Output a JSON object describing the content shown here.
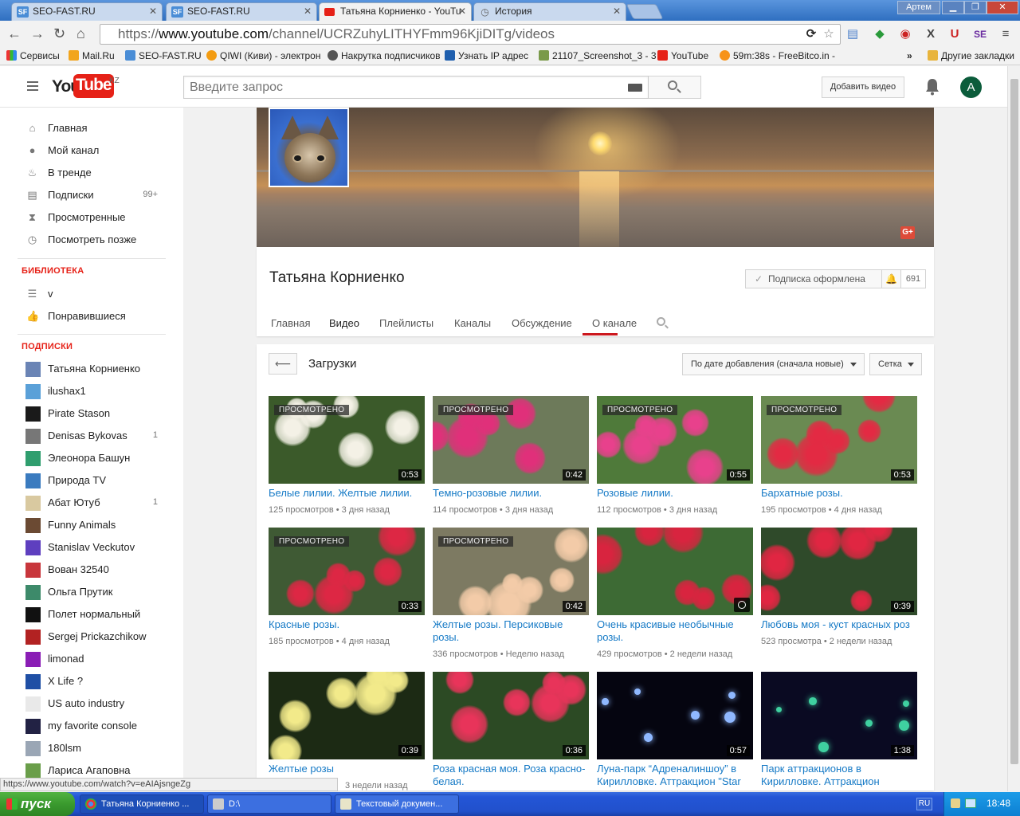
{
  "browser": {
    "tabs": [
      {
        "label": "SEO-FAST.RU",
        "icon": "SF"
      },
      {
        "label": "SEO-FAST.RU",
        "icon": "SF"
      },
      {
        "label": "Татьяна Корниенко - YouTu",
        "icon": "youtube-icon"
      },
      {
        "label": "История",
        "icon": "history-icon"
      }
    ],
    "window_user": "Артем",
    "url_prefix": "https://",
    "url_domain": "www.youtube.com",
    "url_path": "/channel/UCRZuhyLITHYFmm96KjiDITg/videos",
    "bookmarks": [
      {
        "label": "Сервисы"
      },
      {
        "label": "Mail.Ru"
      },
      {
        "label": "SEO-FAST.RU"
      },
      {
        "label": "QIWI (Киви) - электрон"
      },
      {
        "label": "Накрутка подписчиков"
      },
      {
        "label": "Узнать IP адрес"
      },
      {
        "label": "21107_Screenshot_3 - 3"
      },
      {
        "label": "YouTube"
      },
      {
        "label": "59m:38s - FreeBitco.in -"
      }
    ],
    "other_bookmarks": "Другие закладки",
    "status_url": "https://www.youtube.com/watch?v=eAIAjsngeZg"
  },
  "yt_header": {
    "logo_you": "You",
    "logo_tube": "Tube",
    "region": "KZ",
    "search_placeholder": "Введите запрос",
    "upload_label": "Добавить видео",
    "avatar_letter": "A"
  },
  "sidebar": {
    "main": [
      {
        "label": "Главная",
        "icon": "home-icon"
      },
      {
        "label": "Мой канал",
        "icon": "account-icon"
      },
      {
        "label": "В тренде",
        "icon": "flame-icon"
      },
      {
        "label": "Подписки",
        "icon": "subscriptions-icon",
        "count": "99+"
      },
      {
        "label": "Просмотренные",
        "icon": "hourglass-icon"
      },
      {
        "label": "Посмотреть позже",
        "icon": "clock-icon"
      }
    ],
    "library_title": "БИБЛИОТЕКА",
    "library": [
      {
        "label": "v",
        "icon": "playlist-icon"
      },
      {
        "label": "Понравившиеся",
        "icon": "thumbs-up-icon"
      }
    ],
    "subs_title": "ПОДПИСКИ",
    "subs": [
      {
        "label": "Татьяна Корниенко",
        "color": "#6a84b5",
        "count": ""
      },
      {
        "label": "ilushax1",
        "color": "#5aa0d8",
        "count": ""
      },
      {
        "label": "Pirate Stason",
        "color": "#1a1a1a",
        "count": ""
      },
      {
        "label": "Denisas Bykovas",
        "color": "#777777",
        "count": "1"
      },
      {
        "label": "Элеонора Башун",
        "color": "#2f9e6e",
        "count": ""
      },
      {
        "label": "Природа TV",
        "color": "#3a7bbf",
        "count": ""
      },
      {
        "label": "Абат Ютуб",
        "color": "#d9c9a0",
        "count": "1"
      },
      {
        "label": "Funny Animals",
        "color": "#6b4a33",
        "count": ""
      },
      {
        "label": "Stanislav Veckutov",
        "color": "#5e3fbf",
        "count": ""
      },
      {
        "label": "Вован 32540",
        "color": "#c8363c",
        "count": ""
      },
      {
        "label": "Ольга Прутик",
        "color": "#3d8a6a",
        "count": ""
      },
      {
        "label": "Полет нормальный",
        "color": "#111111",
        "count": ""
      },
      {
        "label": "Sergej Prickazchikow",
        "color": "#b22222",
        "count": ""
      },
      {
        "label": "limonad",
        "color": "#8a1db5",
        "count": ""
      },
      {
        "label": "X Life ?",
        "color": "#1f4fa5",
        "count": ""
      },
      {
        "label": "US auto industry",
        "color": "#e9e9e9",
        "count": ""
      },
      {
        "label": "my favorite console",
        "color": "#222244",
        "count": ""
      },
      {
        "label": "180lsm",
        "color": "#9aa6b5",
        "count": ""
      },
      {
        "label": "Лариса Агаповна",
        "color": "#6a9e4a",
        "count": ""
      }
    ]
  },
  "channel": {
    "name": "Татьяна Корниенко",
    "subscribe_label": "Подписка оформлена",
    "subscriber_count": "691",
    "gplus": "G+",
    "tabs": [
      "Главная",
      "Видео",
      "Плейлисты",
      "Каналы",
      "Обсуждение",
      "О канале"
    ]
  },
  "videos_section": {
    "title": "Загрузки",
    "sort_label": "По дате добавления (сначала новые)",
    "view_label": "Сетка",
    "watched_label": "ПРОСМОТРЕНО",
    "items": [
      {
        "title": "Белые лилии. Желтые лилии.",
        "views": "125 просмотров",
        "age": "3 дня назад",
        "duration": "0:53",
        "watched": true,
        "bg": "#3b5a2a",
        "petal": "#f4f1e6"
      },
      {
        "title": "Темно-розовые лилии.",
        "views": "114 просмотров",
        "age": "3 дня назад",
        "duration": "0:42",
        "watched": true,
        "bg": "#6d7a5a",
        "petal": "#e0307a"
      },
      {
        "title": "Розовые лилии.",
        "views": "112 просмотров",
        "age": "3 дня назад",
        "duration": "0:55",
        "watched": true,
        "bg": "#4f7a3a",
        "petal": "#e8418c"
      },
      {
        "title": "Бархатные розы.",
        "views": "195 просмотров",
        "age": "4 дня назад",
        "duration": "0:53",
        "watched": true,
        "bg": "#6a8a52",
        "petal": "#e32a43"
      },
      {
        "title": "Красные розы.",
        "views": "185 просмотров",
        "age": "4 дня назад",
        "duration": "0:33",
        "watched": true,
        "bg": "#3f5a34",
        "petal": "#dd2744"
      },
      {
        "title": "Желтые розы. Персиковые розы.",
        "views": "336 просмотров",
        "age": "Неделю назад",
        "duration": "0:42",
        "watched": true,
        "bg": "#7d7a62",
        "petal": "#f3cba8"
      },
      {
        "title": "Очень красивые необычные розы.",
        "views": "429 просмотров",
        "age": "2 недели назад",
        "duration": "",
        "watched": false,
        "bg": "#3d6a34",
        "petal": "#d8243f"
      },
      {
        "title": "Любовь моя - куст красных роз",
        "views": "523 просмотра",
        "age": "2 недели назад",
        "duration": "0:39",
        "watched": false,
        "bg": "#2f4a2a",
        "petal": "#e02642"
      },
      {
        "title": "Желтые розы",
        "views": "",
        "age": "3 недели назад",
        "duration": "0:39",
        "watched": false,
        "bg": "#1c2a14",
        "petal": "#f2ea8a"
      },
      {
        "title": "Роза красная моя. Роза красно-белая.",
        "views": "",
        "age": "",
        "duration": "0:36",
        "watched": false,
        "bg": "#2c4a24",
        "petal": "#e8345a"
      },
      {
        "title": "Луна-парк “Адреналиншоу” в Кирилловке. Аттракцион \"Star",
        "views": "",
        "age": "",
        "duration": "0:57",
        "watched": false,
        "bg": "#050510",
        "petal": "#8fb8ff"
      },
      {
        "title": "Парк аттракционов в Кирилловке. Аттракцион",
        "views": "",
        "age": "",
        "duration": "1:38",
        "watched": false,
        "bg": "#0a0a22",
        "petal": "#3fd0a0"
      }
    ]
  },
  "taskbar": {
    "start": "пуск",
    "tasks": [
      "Татьяна Корниенко ...",
      "D:\\",
      "Текстовый докумен..."
    ],
    "lang": "RU",
    "time": "18:48"
  }
}
